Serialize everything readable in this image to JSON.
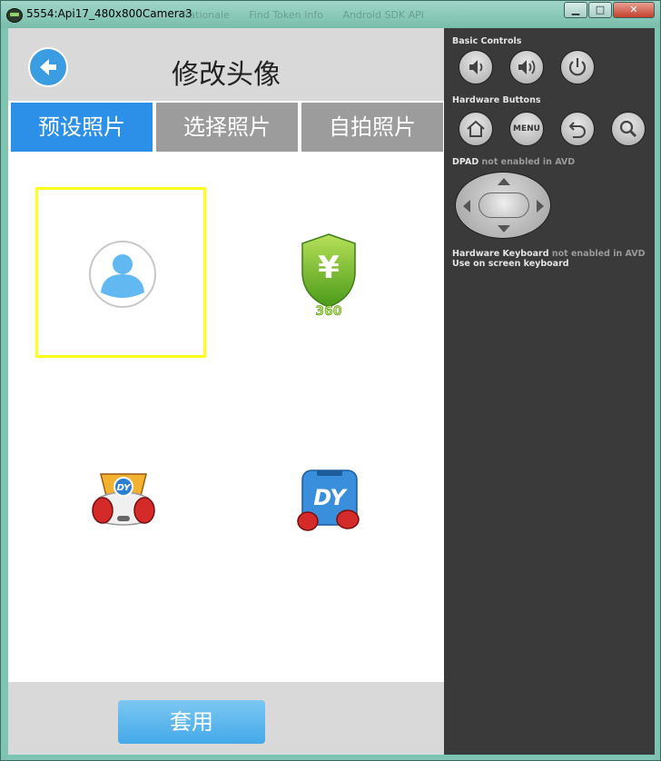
{
  "window": {
    "title": "5554:Api17_480x800Camera3",
    "background_tabs": [
      "Rationale",
      "Find Token Info",
      "Android SDK API"
    ],
    "minimize_symbol": "▁",
    "maximize_symbol": "□",
    "close_symbol": "✕"
  },
  "app": {
    "header": {
      "title": "修改头像",
      "back_icon": "arrow-left-icon"
    },
    "tabs": [
      {
        "label": "预设照片",
        "active": true
      },
      {
        "label": "选择照片",
        "active": false
      },
      {
        "label": "自拍照片",
        "active": false
      }
    ],
    "images": [
      {
        "name": "default-avatar",
        "selected": true
      },
      {
        "name": "360-shield-yen-icon",
        "caption": "360",
        "symbol": "¥",
        "selected": false
      },
      {
        "name": "dy-boxing-gamepad-icon",
        "caption": "DY",
        "selected": false
      },
      {
        "name": "dy-boxing-phone-icon",
        "caption": "DY",
        "selected": false
      }
    ],
    "apply_button": "套用"
  },
  "emulator_panel": {
    "basic_controls_label": "Basic Controls",
    "hardware_buttons_label": "Hardware Buttons",
    "menu_label": "MENU",
    "dpad_label_bold": "DPAD",
    "dpad_label_rest": " not enabled in AVD",
    "keyboard_label_bold": "Hardware Keyboard",
    "keyboard_label_rest": " not enabled in AVD",
    "onscreen_keyboard_label": "Use on screen keyboard"
  },
  "colors": {
    "active_tab": "#2c90e8",
    "inactive_tab": "#9c9c9c",
    "selection_border": "#ffff1a",
    "apply_button": "#44a9e8",
    "panel_bg": "#3a3a3a"
  }
}
